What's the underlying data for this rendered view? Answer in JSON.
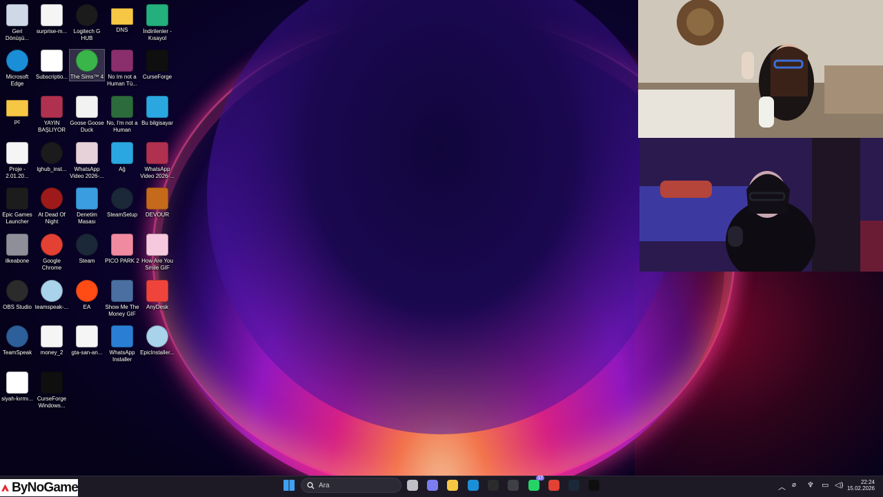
{
  "desktop_icons": [
    {
      "label": "Geri Dönüşü...",
      "icon": "recycle-bin-icon",
      "color": "#cfd8e6"
    },
    {
      "label": "surprise-m...",
      "icon": "video-file-icon",
      "color": "#f5f5f5"
    },
    {
      "label": "Logitech G HUB",
      "icon": "logitech-g-icon",
      "color": "#1b1b1b"
    },
    {
      "label": "DNS",
      "icon": "folder-icon",
      "color": "#f6c744"
    },
    {
      "label": "İndirilenler - Kısayol",
      "icon": "downloads-folder-icon",
      "color": "#23b07c"
    },
    {
      "label": "Microsoft Edge",
      "icon": "edge-icon",
      "color": "#1a8fd8"
    },
    {
      "label": "Subscriptio...",
      "icon": "blank-file-icon",
      "color": "#ffffff"
    },
    {
      "label": "The Sims™ 4",
      "icon": "sims-plumbob-icon",
      "color": "#3ab54a"
    },
    {
      "label": "No Im not a Human Tü...",
      "icon": "winrar-archive-icon",
      "color": "#8a2f6b"
    },
    {
      "label": "CurseForge",
      "icon": "curseforge-icon",
      "color": "#0f0f0f"
    },
    {
      "label": "pc",
      "icon": "folder-icon",
      "color": "#f6c744"
    },
    {
      "label": "YAYIN BAŞLIYOR",
      "icon": "video-file-icon",
      "color": "#b0304f"
    },
    {
      "label": "Goose Goose Duck",
      "icon": "goose-icon",
      "color": "#f2f2f2"
    },
    {
      "label": "No, I'm not a Human",
      "icon": "not-human-game-icon",
      "color": "#2c6b3c"
    },
    {
      "label": "Bu bilgisayar",
      "icon": "monitor-icon",
      "color": "#2aa7e0"
    },
    {
      "label": "Proje - 2.01.20...",
      "icon": "video-file-icon",
      "color": "#f5f5f5"
    },
    {
      "label": "lghub_inst...",
      "icon": "logitech-g-icon",
      "color": "#1b1b1b"
    },
    {
      "label": "WhatsApp Video 2026-...",
      "icon": "video-thumbnail-icon",
      "color": "#e7d2da"
    },
    {
      "label": "Ağ",
      "icon": "network-icon",
      "color": "#2aa7e0"
    },
    {
      "label": "WhatsApp Video 2026-...",
      "icon": "video-file-icon",
      "color": "#b0304f"
    },
    {
      "label": "Epic Games Launcher",
      "icon": "epic-games-icon",
      "color": "#1c1c1c"
    },
    {
      "label": "At Dead Of Night",
      "icon": "dead-of-night-icon",
      "color": "#9e1a1a"
    },
    {
      "label": "Denetim Masası",
      "icon": "control-panel-icon",
      "color": "#3a9de0"
    },
    {
      "label": "SteamSetup",
      "icon": "steam-setup-icon",
      "color": "#1b2838"
    },
    {
      "label": "DEVOUR",
      "icon": "devour-icon",
      "color": "#c46a1a"
    },
    {
      "label": "ilkeabone",
      "icon": "raccoon-icon",
      "color": "#8f8f9a"
    },
    {
      "label": "Google Chrome",
      "icon": "chrome-icon",
      "color": "#e34133"
    },
    {
      "label": "Steam",
      "icon": "steam-icon",
      "color": "#1b2838"
    },
    {
      "label": "PICO PARK 2",
      "icon": "pico-park-icon",
      "color": "#f08aa0"
    },
    {
      "label": "How Are You Smile GIF",
      "icon": "pink-image-icon",
      "color": "#f7c9de"
    },
    {
      "label": "OBS Studio",
      "icon": "obs-icon",
      "color": "#2b2b2b"
    },
    {
      "label": "teamspeak-...",
      "icon": "cd-installer-icon",
      "color": "#a9d3ea"
    },
    {
      "label": "EA",
      "icon": "ea-icon",
      "color": "#ff4b14"
    },
    {
      "label": "Show Me The Money GIF",
      "icon": "photo-thumbnail-icon",
      "color": "#4a6fa0"
    },
    {
      "label": "AnyDesk",
      "icon": "anydesk-icon",
      "color": "#ef443b"
    },
    {
      "label": "TeamSpeak",
      "icon": "teamspeak-icon",
      "color": "#2d5f9a"
    },
    {
      "label": "money_2",
      "icon": "video-file-icon",
      "color": "#f5f5f5"
    },
    {
      "label": "gta-san-an...",
      "icon": "video-file-icon",
      "color": "#f5f5f5"
    },
    {
      "label": "WhatsApp Installer",
      "icon": "download-installer-icon",
      "color": "#2a7fd4"
    },
    {
      "label": "EpicInstaller...",
      "icon": "cd-installer-icon",
      "color": "#a9d3ea"
    },
    {
      "label": "siyah-kırmı...",
      "icon": "bynogame-banner-icon",
      "color": "#ffffff"
    },
    {
      "label": "CurseForge Windows...",
      "icon": "curseforge-icon",
      "color": "#0f0f0f"
    }
  ],
  "webcams": [
    {
      "name": "webcam-top"
    },
    {
      "name": "webcam-bottom"
    }
  ],
  "taskbar": {
    "search_placeholder": "Ara",
    "apps": [
      {
        "icon": "windows-start-icon",
        "color": "#3fa0f0"
      },
      {
        "icon": "task-view-icon",
        "color": "#bfbfc6"
      },
      {
        "icon": "copilot-icon",
        "color": "#7a7cf0"
      },
      {
        "icon": "file-explorer-icon",
        "color": "#f6c744"
      },
      {
        "icon": "edge-icon",
        "color": "#1a8fd8"
      },
      {
        "icon": "obs-icon",
        "color": "#2b2b2b"
      },
      {
        "icon": "microsoft-store-icon",
        "color": "#3f3f46"
      },
      {
        "icon": "whatsapp-icon",
        "color": "#25d366",
        "badge": "17"
      },
      {
        "icon": "chrome-icon",
        "color": "#e34133"
      },
      {
        "icon": "steam-icon",
        "color": "#1b2838"
      },
      {
        "icon": "curseforge-icon",
        "color": "#0f0f0f"
      }
    ],
    "clock_time": "22:24",
    "clock_date": "15.02.2026"
  },
  "brand_overlay": {
    "text": "ByNoGame",
    "accent": "#e4262c"
  }
}
